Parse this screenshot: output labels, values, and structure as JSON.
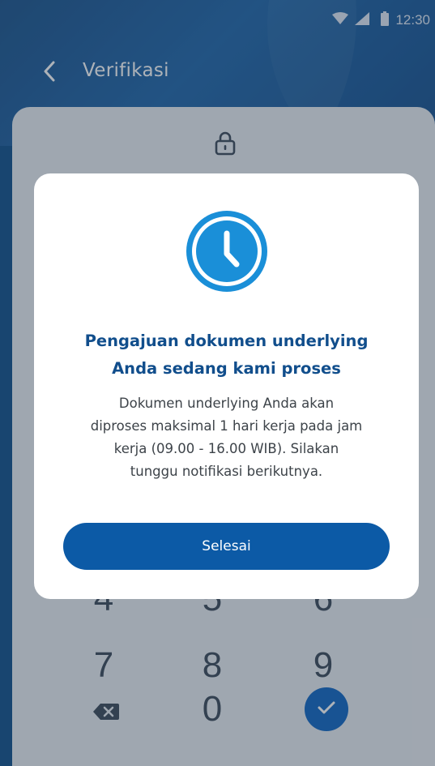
{
  "status_bar": {
    "time": "12:30"
  },
  "header": {
    "title": "Verifikasi"
  },
  "keypad": {
    "row2": [
      "4",
      "5",
      "6"
    ],
    "row3": [
      "7",
      "8",
      "9"
    ],
    "zero": "0"
  },
  "dialog": {
    "title_line1": "Pengajuan dokumen underlying",
    "title_line2": "Anda sedang kami proses",
    "body_line1": "Dokumen underlying Anda akan",
    "body_line2": "diproses maksimal 1 hari kerja pada jam",
    "body_line3": "kerja (09.00 - 16.00 WIB). Silakan",
    "body_line4": "tunggu notifikasi berikutnya.",
    "button_label": "Selesai"
  },
  "colors": {
    "header_blue": "#0e4a86",
    "accent_blue": "#0c5aa6",
    "title_blue": "#114e8c",
    "clock_blue": "#1a8fd8"
  },
  "icons": [
    "wifi-icon",
    "signal-icon",
    "battery-icon",
    "back-arrow-icon",
    "lock-icon",
    "clock-icon",
    "backspace-icon",
    "check-icon"
  ]
}
